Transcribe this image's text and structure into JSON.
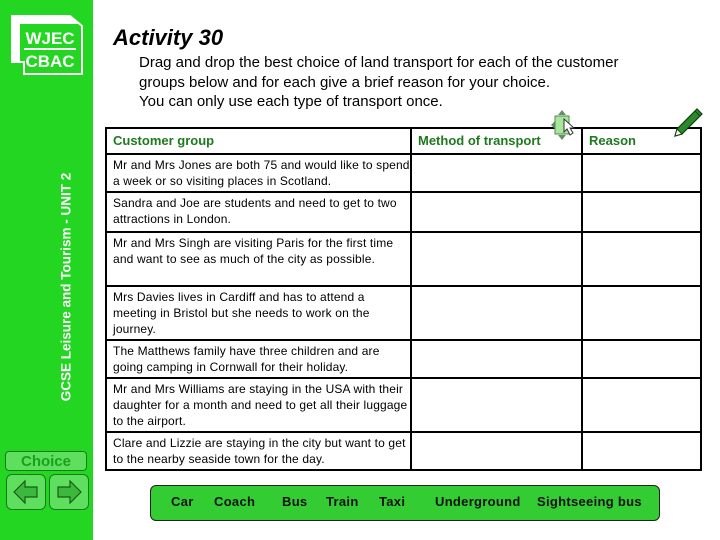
{
  "sidebar": {
    "logo": {
      "line1": "WJEC",
      "line2": "CBAC"
    },
    "vertical_title": "GCSE Leisure and Tourism - UNIT 2",
    "choice_label": "Choice",
    "prev_icon": "left-arrow-icon",
    "next_icon": "right-arrow-icon"
  },
  "header": {
    "title": "Activity 30",
    "instructions": [
      "Drag and drop the best choice of land transport for each of the customer",
      "groups below and for each give a brief reason for your choice.",
      "You can only use each type of transport once."
    ]
  },
  "table": {
    "headers": [
      "Customer group",
      "Method of transport",
      "Reason"
    ],
    "rows": [
      {
        "group": "Mr and Mrs Jones are both 75 and would like to spend a week or so visiting places in Scotland.",
        "method": "",
        "reason": ""
      },
      {
        "group": "Sandra and Joe are students and need to get to two attractions in London.",
        "method": "",
        "reason": ""
      },
      {
        "group": "Mr and Mrs Singh are visiting Paris for the first time and want to see as much of the city as possible.",
        "method": "",
        "reason": ""
      },
      {
        "group": "Mrs Davies lives in Cardiff and has to attend a meeting in Bristol but she needs to work on the journey.",
        "method": "",
        "reason": ""
      },
      {
        "group": "The Matthews family have three children and are going camping in Cornwall for their holiday.",
        "method": "",
        "reason": ""
      },
      {
        "group": "Mr and Mrs Williams are staying in the USA with their daughter for a month and need to get all their luggage to the airport.",
        "method": "",
        "reason": ""
      },
      {
        "group": "Clare and Lizzie are staying in the city but want to get to the nearby seaside town for the day.",
        "method": "",
        "reason": ""
      }
    ]
  },
  "icons": {
    "move": "drag-move-icon",
    "pencil": "pencil-icon"
  },
  "transport_options": [
    "Car",
    "Coach",
    "Bus",
    "Train",
    "Taxi",
    "Underground",
    "Sightseeing bus"
  ],
  "colors": {
    "sidebar_green": "#22d622",
    "header_green": "#1f7a1f",
    "options_bar": "#33cc33"
  }
}
